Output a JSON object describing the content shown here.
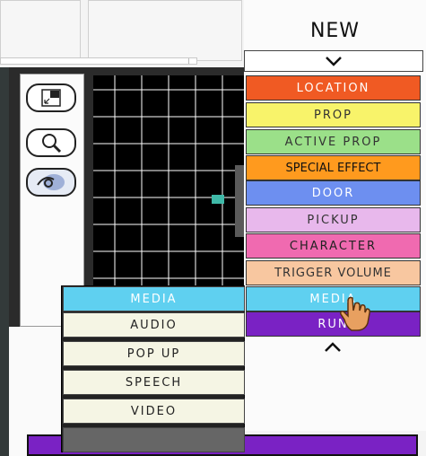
{
  "header": {
    "title": "NEW"
  },
  "tools": [
    {
      "name": "fullscreen-icon"
    },
    {
      "name": "zoom-icon"
    },
    {
      "name": "hide-eye-icon"
    }
  ],
  "menu": {
    "scroll_up_icon": "chevron-down-icon",
    "scroll_down_icon": "chevron-up-icon",
    "items": [
      {
        "label": "LOCATION",
        "color": "#f05a23",
        "text_color": "#ffffff"
      },
      {
        "label": "PROP",
        "color": "#f8f36a",
        "text_color": "#333333"
      },
      {
        "label": "ACTIVE PROP",
        "color": "#9be089",
        "text_color": "#333333"
      },
      {
        "label": "SPECIAL EFFECT",
        "color": "#ff9a1e",
        "text_color": "#111111"
      },
      {
        "label": "DOOR",
        "color": "#6d8ff0",
        "text_color": "#ffffff"
      },
      {
        "label": "PICKUP",
        "color": "#e8b8ec",
        "text_color": "#333333"
      },
      {
        "label": "CHARACTER",
        "color": "#f06ab0",
        "text_color": "#222222"
      },
      {
        "label": "TRIGGER VOLUME",
        "color": "#f8c7a0",
        "text_color": "#333333"
      },
      {
        "label": "MEDIA",
        "color": "#5fd0f0",
        "text_color": "#ffffff"
      },
      {
        "label": "RUN",
        "color": "#7a22c4",
        "text_color": "#ffffff"
      }
    ]
  },
  "submenu": {
    "items": [
      {
        "label": "MEDIA",
        "color": "#5fd0f0",
        "text_color": "#ffffff"
      },
      {
        "label": "AUDIO"
      },
      {
        "label": "POP UP"
      },
      {
        "label": "SPEECH"
      },
      {
        "label": "VIDEO"
      }
    ]
  },
  "colors": {
    "bottom_bar": "#7a22c4"
  }
}
